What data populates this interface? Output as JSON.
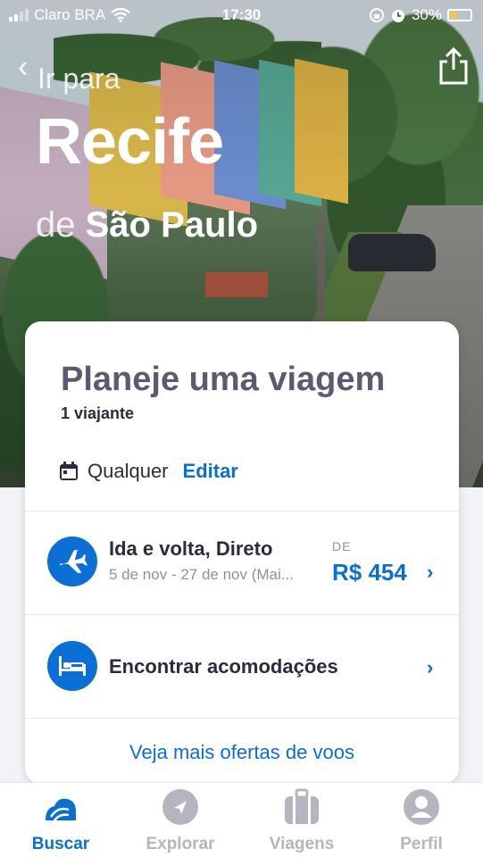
{
  "status_bar": {
    "carrier": "Claro BRA",
    "time": "17:30",
    "battery": "30%"
  },
  "hero": {
    "go_to_label": "Ir para",
    "destination": "Recife",
    "origin_prefix": "de",
    "origin": "São Paulo"
  },
  "card": {
    "title": "Planeje uma viagem",
    "travelers": "1 viajante",
    "dates": "Qualquer",
    "edit_label": "Editar",
    "flight": {
      "title": "Ida e volta, Direto",
      "dates": "5 de nov - 27 de nov (Mai...",
      "price_prefix": "DE",
      "price": "R$ 454"
    },
    "lodging": {
      "title": "Encontrar acomodações"
    },
    "more_offers": "Veja mais ofertas de voos"
  },
  "tabs": [
    {
      "label": "Buscar",
      "icon": "skyscanner-logo-icon",
      "active": true
    },
    {
      "label": "Explorar",
      "icon": "compass-icon",
      "active": false
    },
    {
      "label": "Viagens",
      "icon": "suitcase-icon",
      "active": false
    },
    {
      "label": "Perfil",
      "icon": "profile-icon",
      "active": false
    }
  ],
  "colors": {
    "accent": "#0a6fce",
    "title_text": "#595b73",
    "inactive_tab": "#b4b5bf"
  }
}
